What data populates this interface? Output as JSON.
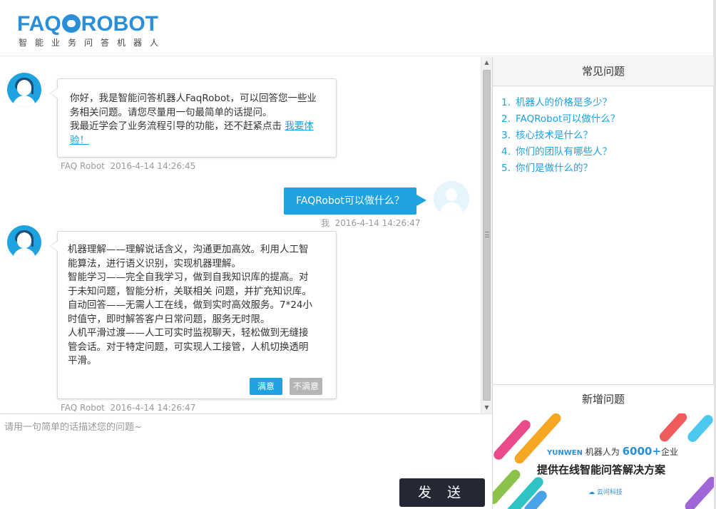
{
  "header": {
    "logo_text": "FAQ ROBOT",
    "logo_sub": "智能业务问答机器人"
  },
  "chat": {
    "messages": [
      {
        "sender": "FAQ Robot",
        "text_lines": [
          "你好，我是智能问答机器人FaqRobot，可以回答您一些业",
          "务相关问题。请您尽量用一句最简单的话提问。",
          "我最近学会了业务流程引导的功能，还不赶紧点击 "
        ],
        "link_text": "我要体验！",
        "link_line_1": "我要体",
        "link_line_2": "验！",
        "time": "2016-4-14 14:26:45"
      },
      {
        "sender": "我",
        "text": "FAQRobot可以做什么？",
        "time": "2016-4-14 14:26:47"
      },
      {
        "sender": "FAQ Robot",
        "text_lines": [
          "机器理解——理解说话含义，沟通更加高效。利用人工智",
          "能算法，进行语义识别，实现机器理解。",
          "智能学习——完全自我学习，做到自我知识库的提高。对",
          "于未知问题，智能分析，关联相关 问题，并扩充知识库。",
          "自动回答——无需人工在线，做到实时高效服务。7*24小",
          "时值守，即时解答客户日常问题，服务无时限。",
          "人机平滑过渡——人工可实时监视聊天，轻松做到无缝接",
          "管会话。对于特定问题，可实现人工接管，人机切换透明",
          "平滑。"
        ],
        "btn_satisfied": "满意",
        "btn_unsatisfied": "不满意",
        "time": "2016-4-14 14:26:47"
      }
    ]
  },
  "input": {
    "placeholder": "请用一句简单的话描述您的问题~",
    "send_label": "发 送"
  },
  "faq": {
    "title": "常见问题",
    "items": [
      {
        "num": "1.",
        "text": "机器人的价格是多少？"
      },
      {
        "num": "2.",
        "text": "FAQRobot可以做什么？"
      },
      {
        "num": "3.",
        "text": "核心技术是什么？"
      },
      {
        "num": "4.",
        "text": "你们的团队有哪些人？"
      },
      {
        "num": "5.",
        "text": "你们是做什么的？"
      }
    ],
    "new_title": "新增问题"
  },
  "banner": {
    "brand": "YUNWEN",
    "line1_mid": " 机器人为 ",
    "line1_big": "6000+",
    "line1_end": "企业",
    "line2": "提供在线智能问答解决方案",
    "line3": "云问科技"
  },
  "colors": {
    "accent": "#1fa3e0",
    "send_button": "#252734",
    "unsatisfied_button": "#b5b5b5"
  }
}
